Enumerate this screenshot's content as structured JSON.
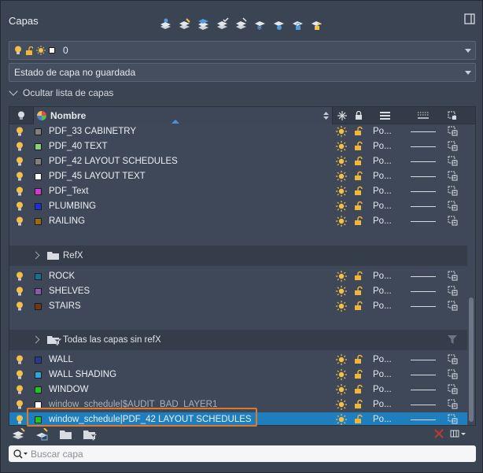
{
  "panel": {
    "title": "Capas"
  },
  "current_layer": {
    "value": "0"
  },
  "layer_state": {
    "value": "Estado de capa no guardada"
  },
  "toggle_list": {
    "label": "Ocultar lista de capas"
  },
  "header": {
    "name": "Nombre"
  },
  "groups": {
    "refx": "RefX",
    "all_no_refx": "Todas las capas sin refX"
  },
  "rows_a": [
    {
      "name": "PDF_33 CABINETRY",
      "color": "#808080",
      "plot": "Po..."
    },
    {
      "name": "PDF_40 TEXT",
      "color": "#8cd074",
      "plot": "Po..."
    },
    {
      "name": "PDF_42 LAYOUT SCHEDULES",
      "color": "#808080",
      "plot": "Po..."
    },
    {
      "name": "PDF_45 LAYOUT TEXT",
      "color": "#ffffff",
      "plot": "Po..."
    },
    {
      "name": "PDF_Text",
      "color": "#d13ad1",
      "plot": "Po..."
    },
    {
      "name": "PLUMBING",
      "color": "#1c2fd8",
      "plot": "Po..."
    },
    {
      "name": "RAILING",
      "color": "#9a6a10",
      "plot": "Po..."
    }
  ],
  "rows_b": [
    {
      "name": "ROCK",
      "color": "#1a6f8a",
      "plot": "Po..."
    },
    {
      "name": "SHELVES",
      "color": "#8a5aa8",
      "plot": "Po..."
    },
    {
      "name": "STAIRS",
      "color": "#6a3a12",
      "plot": "Po..."
    }
  ],
  "rows_c": [
    {
      "name": "WALL",
      "color": "#2a3a8c",
      "plot": "Po...",
      "dim": false
    },
    {
      "name": "WALL SHADING",
      "color": "#2aa8d8",
      "plot": "Po...",
      "dim": false
    },
    {
      "name": "WINDOW",
      "color": "#1ec81e",
      "plot": "Po...",
      "dim": false
    },
    {
      "name": "window_schedule|$AUDIT_BAD_LAYER1",
      "color": "#ffffff",
      "plot": "Po...",
      "dim": true
    },
    {
      "name": "window_schedule|PDF_42 LAYOUT SCHEDULES",
      "color": "#1ec81e",
      "plot": "Po...",
      "dim": false,
      "selected": true
    }
  ],
  "search": {
    "placeholder": "Buscar capa"
  },
  "colors": {
    "accent": "#1f7ebd",
    "highlight": "#e0782a",
    "bulb": "#f5c046"
  }
}
